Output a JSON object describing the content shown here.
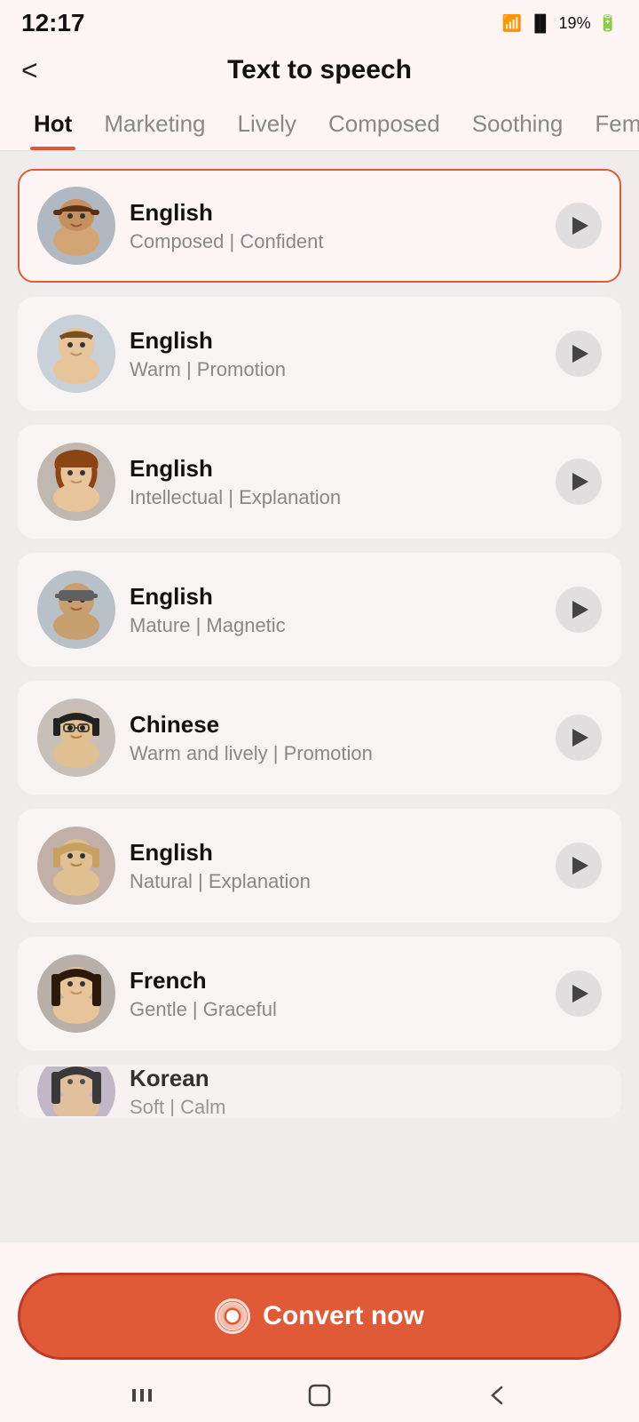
{
  "statusBar": {
    "time": "12:17",
    "batteryPercent": "19%"
  },
  "header": {
    "backLabel": "<",
    "title": "Text to speech"
  },
  "tabs": [
    {
      "id": "hot",
      "label": "Hot",
      "active": true
    },
    {
      "id": "marketing",
      "label": "Marketing",
      "active": false
    },
    {
      "id": "lively",
      "label": "Lively",
      "active": false
    },
    {
      "id": "composed",
      "label": "Composed",
      "active": false
    },
    {
      "id": "soothing",
      "label": "Soothing",
      "active": false
    },
    {
      "id": "female",
      "label": "Female",
      "active": false
    }
  ],
  "voices": [
    {
      "id": 1,
      "language": "English",
      "description": "Composed | Confident",
      "selected": true,
      "avatarType": "male1"
    },
    {
      "id": 2,
      "language": "English",
      "description": "Warm | Promotion",
      "selected": false,
      "avatarType": "male2"
    },
    {
      "id": 3,
      "language": "English",
      "description": "Intellectual | Explanation",
      "selected": false,
      "avatarType": "female1"
    },
    {
      "id": 4,
      "language": "English",
      "description": "Mature | Magnetic",
      "selected": false,
      "avatarType": "male3"
    },
    {
      "id": 5,
      "language": "Chinese",
      "description": "Warm and lively | Promotion",
      "selected": false,
      "avatarType": "female2"
    },
    {
      "id": 6,
      "language": "English",
      "description": "Natural | Explanation",
      "selected": false,
      "avatarType": "female3"
    },
    {
      "id": 7,
      "language": "French",
      "description": "Gentle | Graceful",
      "selected": false,
      "avatarType": "female4"
    },
    {
      "id": 8,
      "language": "Korean",
      "description": "...",
      "selected": false,
      "avatarType": "female5",
      "partial": true
    }
  ],
  "convertButton": {
    "label": "Convert now"
  },
  "bottomNav": {
    "items": [
      "|||",
      "○",
      "<"
    ]
  }
}
